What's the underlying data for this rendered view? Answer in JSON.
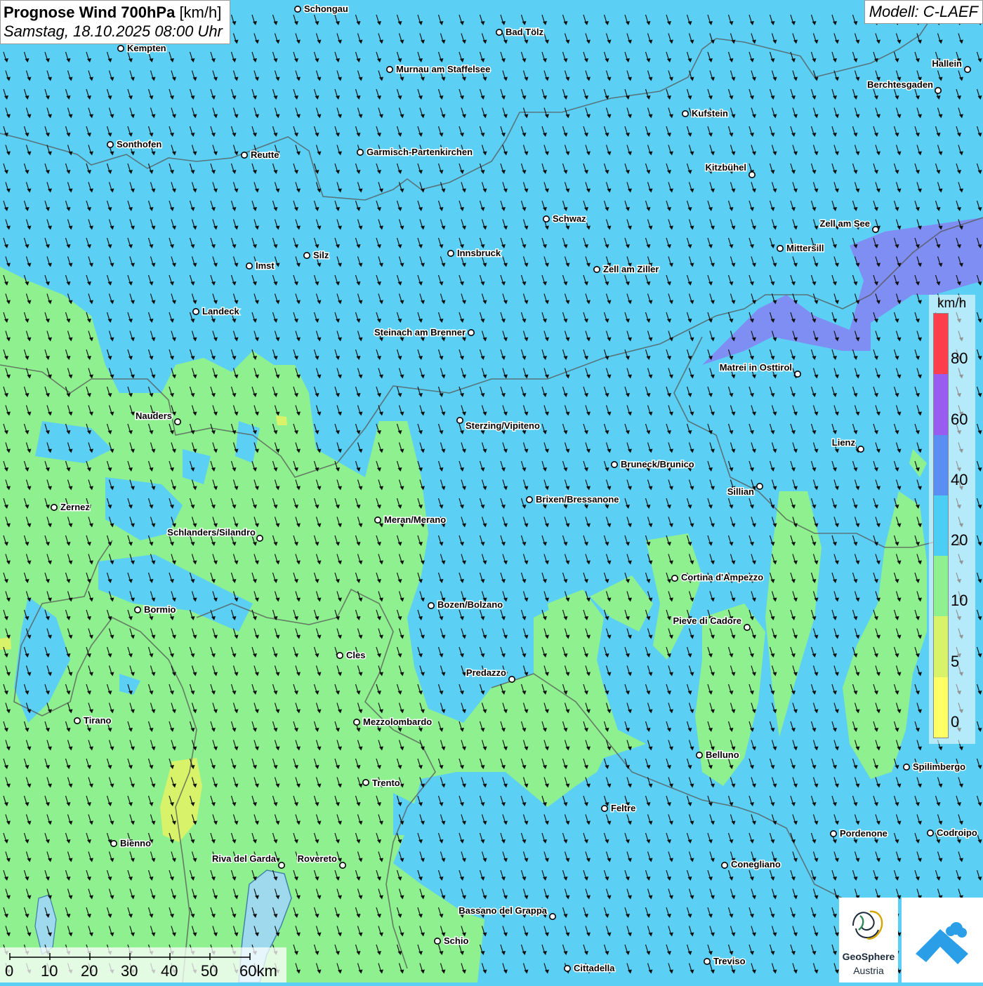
{
  "header": {
    "title_bold": "Prognose Wind 700hPa",
    "title_unit": "[km/h]",
    "datetime": "Samstag, 18.10.2025 08:00 Uhr",
    "model": "Modell: C-LAEF"
  },
  "legend": {
    "unit": "km/h",
    "bands": [
      {
        "color": "#ffff66",
        "label": "0"
      },
      {
        "color": "#d8f36a",
        "label": "5"
      },
      {
        "color": "#8ef08f",
        "label": "10"
      },
      {
        "color": "#4ccdf3",
        "label": "20"
      },
      {
        "color": "#5b8ef3",
        "label": "40"
      },
      {
        "color": "#9a5bf0",
        "label": "60"
      },
      {
        "color": "#ff3e4b",
        "label": "80"
      }
    ]
  },
  "wind_field": {
    "arrow_direction": "south-southeast",
    "colors": {
      "calm_green": "#8ef08f",
      "light_blue": "#5cd0f4",
      "purple_blue": "#7f8ef2",
      "yellow_green": "#d8f36a"
    }
  },
  "cities": [
    {
      "name": "Schongau"
    },
    {
      "name": "Bad Tölz"
    },
    {
      "name": "Kempten"
    },
    {
      "name": "Murnau am Staffelsee"
    },
    {
      "name": "Hallein"
    },
    {
      "name": "Berchtesgaden"
    },
    {
      "name": "Kufstein"
    },
    {
      "name": "Sonthofen"
    },
    {
      "name": "Reutte"
    },
    {
      "name": "Garmisch-Partenkirchen"
    },
    {
      "name": "Kitzbühel"
    },
    {
      "name": "Schwaz"
    },
    {
      "name": "Zell am See"
    },
    {
      "name": "Mittersill"
    },
    {
      "name": "Innsbruck"
    },
    {
      "name": "Silz"
    },
    {
      "name": "Imst"
    },
    {
      "name": "Zell am Ziller"
    },
    {
      "name": "Landeck"
    },
    {
      "name": "Steinach am Brenner"
    },
    {
      "name": "Matrei in Osttirol"
    },
    {
      "name": "Nauders"
    },
    {
      "name": "Sterzing/Vipiteno"
    },
    {
      "name": "Lienz"
    },
    {
      "name": "Bruneck/Brunico"
    },
    {
      "name": "Sillian"
    },
    {
      "name": "Zernez"
    },
    {
      "name": "Brixen/Bressanone"
    },
    {
      "name": "Meran/Merano"
    },
    {
      "name": "Schlanders/Silandro"
    },
    {
      "name": "Cortina d'Ampezzo"
    },
    {
      "name": "Bozen/Bolzano"
    },
    {
      "name": "Bormio"
    },
    {
      "name": "Pieve di Cadore"
    },
    {
      "name": "Cles"
    },
    {
      "name": "Predazzo"
    },
    {
      "name": "Tirano"
    },
    {
      "name": "Mezzolombardo"
    },
    {
      "name": "Belluno"
    },
    {
      "name": "Spilimbergo"
    },
    {
      "name": "Trento"
    },
    {
      "name": "Feltre"
    },
    {
      "name": "Pordenone"
    },
    {
      "name": "Codroipo"
    },
    {
      "name": "Bienno"
    },
    {
      "name": "Riva del Garda"
    },
    {
      "name": "Rovereto"
    },
    {
      "name": "Conegliano"
    },
    {
      "name": "Bassano del Grappa"
    },
    {
      "name": "Schio"
    },
    {
      "name": "Treviso"
    },
    {
      "name": "Cittadella"
    }
  ],
  "scale": {
    "labels": [
      "0",
      "10",
      "20",
      "30",
      "40",
      "50",
      "60km"
    ]
  },
  "logos": {
    "geosphere_line1": "GeoSphere",
    "geosphere_line2": "Austria"
  }
}
